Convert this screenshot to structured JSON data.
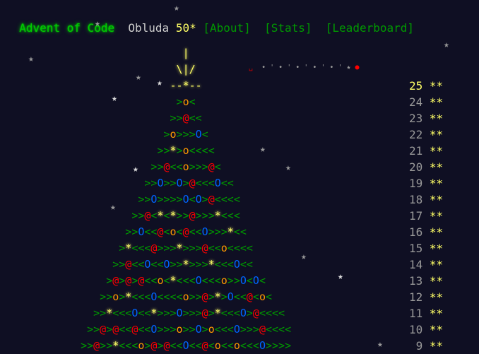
{
  "header": {
    "logo": "Advent of Code",
    "username": "Obluda",
    "star_count": "50*",
    "nav": [
      "[About]",
      "[Stats]",
      "[Leaderboard]"
    ]
  },
  "tree_rows": [
    "                  |",
    "                 \\|/",
    "                --*--",
    "                 >o<",
    "                >>@<<",
    "               >o>>>O<",
    "              >>*>o<<<<",
    "             >>@<<o>>>@<",
    "            >>O>>O>@<<<O<<",
    "           >>O>>>>O<O>@<<<<",
    "          >>@<*<*>>@>>>*<<<",
    "         >>O<<@<o<@<<O>>>*<<",
    "        >*<<<@>>>*>>>@<<o<<<<",
    "       >>@<<O<<O>>*>>>*<<<O<<",
    "      >@>@>@<<o<*<<<O<<<o>>O<O<",
    "     >>o>*<<<O<<<<o>>@>*>O<<@<o<",
    "    >>*<<<O<<*>>>O>>>@>*<<<O>@<<<<",
    "   >>@>@<<@<<O>>>o>>O>o<<<O>>>@<<<<",
    "  >>@>>*<<<o>@>@<<O<<@<o<<o<<<O>>>>"
  ],
  "days": [
    {
      "n": "25",
      "stars": "**"
    },
    {
      "n": "24",
      "stars": "**"
    },
    {
      "n": "23",
      "stars": "**"
    },
    {
      "n": "22",
      "stars": "**"
    },
    {
      "n": "21",
      "stars": "**"
    },
    {
      "n": "20",
      "stars": "**"
    },
    {
      "n": "19",
      "stars": "**"
    },
    {
      "n": "18",
      "stars": "**"
    },
    {
      "n": "17",
      "stars": "**"
    },
    {
      "n": "16",
      "stars": "**"
    },
    {
      "n": "15",
      "stars": "**"
    },
    {
      "n": "14",
      "stars": "**"
    },
    {
      "n": "13",
      "stars": "**"
    },
    {
      "n": "12",
      "stars": "**"
    },
    {
      "n": "11",
      "stars": "**"
    },
    {
      "n": "10",
      "stars": "**"
    },
    {
      "n": "9",
      "stars": "**"
    }
  ],
  "colors": {
    "background": "#0f0f23",
    "logo": "#00cc00",
    "nav": "#009900",
    "star": "#ffff66",
    "ornament_red": "#ff0000",
    "ornament_orange": "#ff9900",
    "ornament_blue": "#0066ff"
  }
}
